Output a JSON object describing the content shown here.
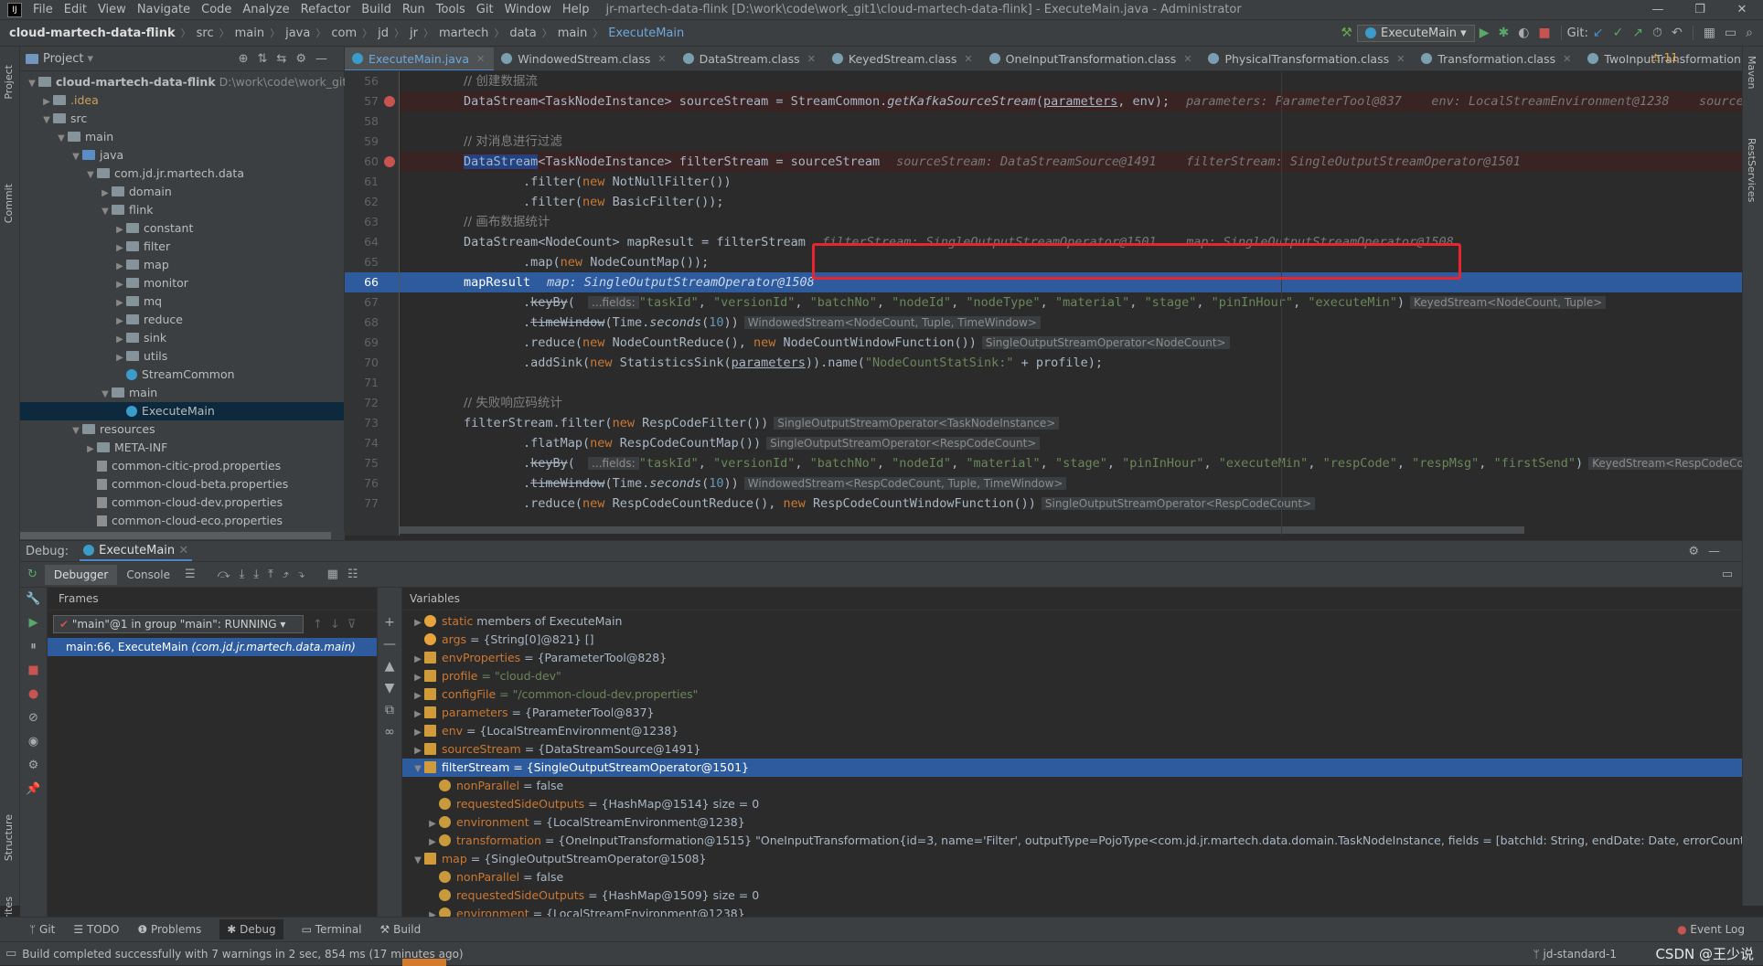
{
  "menu": [
    "File",
    "Edit",
    "View",
    "Navigate",
    "Code",
    "Analyze",
    "Refactor",
    "Build",
    "Run",
    "Tools",
    "Git",
    "Window",
    "Help"
  ],
  "window_title": "jr-martech-data-flink [D:\\work\\code\\work_git1\\cloud-martech-data-flink] - ExecuteMain.java - Administrator",
  "breadcrumbs": [
    "cloud-martech-data-flink",
    "src",
    "main",
    "java",
    "com",
    "jd",
    "jr",
    "martech",
    "data",
    "main",
    "ExecuteMain"
  ],
  "run_config": "ExecuteMain",
  "git_label": "Git:",
  "project": {
    "header": "Project",
    "root_name": "cloud-martech-data-flink",
    "root_path": "D:\\work\\code\\work_git1\\c",
    "tree": [
      {
        "label": ".idea",
        "indent": 1,
        "type": "folder"
      },
      {
        "label": "src",
        "indent": 1,
        "type": "folder"
      },
      {
        "label": "main",
        "indent": 2,
        "type": "folder"
      },
      {
        "label": "java",
        "indent": 3,
        "type": "src"
      },
      {
        "label": "com.jd.jr.martech.data",
        "indent": 4,
        "type": "folder"
      },
      {
        "label": "domain",
        "indent": 5,
        "type": "folder"
      },
      {
        "label": "flink",
        "indent": 5,
        "type": "folder"
      },
      {
        "label": "constant",
        "indent": 6,
        "type": "folder"
      },
      {
        "label": "filter",
        "indent": 6,
        "type": "folder"
      },
      {
        "label": "map",
        "indent": 6,
        "type": "folder"
      },
      {
        "label": "monitor",
        "indent": 6,
        "type": "folder"
      },
      {
        "label": "mq",
        "indent": 6,
        "type": "folder"
      },
      {
        "label": "reduce",
        "indent": 6,
        "type": "folder"
      },
      {
        "label": "sink",
        "indent": 6,
        "type": "folder"
      },
      {
        "label": "utils",
        "indent": 6,
        "type": "folder"
      },
      {
        "label": "StreamCommon",
        "indent": 6,
        "type": "class"
      },
      {
        "label": "main",
        "indent": 5,
        "type": "folder"
      },
      {
        "label": "ExecuteMain",
        "indent": 6,
        "type": "class"
      },
      {
        "label": "resources",
        "indent": 3,
        "type": "folder"
      },
      {
        "label": "META-INF",
        "indent": 4,
        "type": "folder"
      },
      {
        "label": "common-citic-prod.properties",
        "indent": 4,
        "type": "prop"
      },
      {
        "label": "common-cloud-beta.properties",
        "indent": 4,
        "type": "prop"
      },
      {
        "label": "common-cloud-dev.properties",
        "indent": 4,
        "type": "prop"
      },
      {
        "label": "common-cloud-eco.properties",
        "indent": 4,
        "type": "prop"
      }
    ]
  },
  "tabs": [
    "ExecuteMain.java",
    "WindowedStream.class",
    "DataStream.class",
    "KeyedStream.class",
    "OneInputTransformation.class",
    "PhysicalTransformation.class",
    "Transformation.class",
    "TwoInputTransformation.class"
  ],
  "warnings": "⚠ 11",
  "editor": {
    "line_numbers": [
      "56",
      "57",
      "58",
      "59",
      "60",
      "61",
      "62",
      "63",
      "64",
      "65",
      "66",
      "67",
      "68",
      "69",
      "70",
      "71",
      "72",
      "73",
      "74",
      "75",
      "76",
      "77"
    ],
    "cmt56": "// 创建数据流",
    "cmt59": "// 对消息进行过滤",
    "cmt63": "// 画布数据统计",
    "cmt72": "// 失败响应码统计",
    "l57_inline": "parameters: ParameterTool@837    env: LocalStreamEnvironment@1238    sourceSt",
    "l60_inline": "sourceStream: DataStreamSource@1491    filterStream: SingleOutputStreamOperator@1501",
    "l64_inline": "filterStream: SingleOutputStreamOperator@1501    map: SingleOutputStreamOperator@1508",
    "l66_inline": "map: SingleOutputStreamOperator@1508",
    "fields_hint": "...fields:",
    "h67": "KeyedStream<NodeCount, Tuple>",
    "h68": "WindowedStream<NodeCount, Tuple, TimeWindow>",
    "h69": "SingleOutputStreamOperator<NodeCount>",
    "h73": "SingleOutputStreamOperator<TaskNodeInstance>",
    "h74": "SingleOutputStreamOperator<RespCodeCount>",
    "h75": "KeyedStream<RespCodeCount",
    "h76": "WindowedStream<RespCodeCount, Tuple, TimeWindow>",
    "h77": "SingleOutputStreamOperator<RespCodeCount>"
  },
  "debug": {
    "label": "Debug:",
    "session": "ExecuteMain",
    "tab_debugger": "Debugger",
    "tab_console": "Console",
    "frames_label": "Frames",
    "variables_label": "Variables",
    "thread": "\"main\"@1 in group \"main\": RUNNING",
    "frame": "main:66, ExecuteMain",
    "frame_pkg": "(com.jd.jr.martech.data.main)",
    "vars": [
      {
        "name": "static",
        "value": "members of ExecuteMain",
        "indent": 0,
        "icon": "static",
        "expand": "right"
      },
      {
        "name": "args",
        "value": "= {String[0]@821} []",
        "indent": 0,
        "icon": "param",
        "expand": ""
      },
      {
        "name": "envProperties",
        "value": "= {ParameterTool@828}",
        "indent": 0,
        "icon": "list",
        "expand": "right"
      },
      {
        "name": "profile",
        "value": "= \"cloud-dev\"",
        "indent": 0,
        "icon": "list",
        "expand": "right"
      },
      {
        "name": "configFile",
        "value": "= \"/common-cloud-dev.properties\"",
        "indent": 0,
        "icon": "list",
        "expand": "right"
      },
      {
        "name": "parameters",
        "value": "= {ParameterTool@837}",
        "indent": 0,
        "icon": "list",
        "expand": "right"
      },
      {
        "name": "env",
        "value": "= {LocalStreamEnvironment@1238}",
        "indent": 0,
        "icon": "list",
        "expand": "right"
      },
      {
        "name": "sourceStream",
        "value": "= {DataStreamSource@1491}",
        "indent": 0,
        "icon": "list",
        "expand": "right"
      },
      {
        "name": "filterStream",
        "value": "= {SingleOutputStreamOperator@1501}",
        "indent": 0,
        "icon": "list",
        "expand": "down",
        "sel": true
      },
      {
        "name": "nonParallel",
        "value": "= false",
        "indent": 1,
        "icon": "field",
        "expand": ""
      },
      {
        "name": "requestedSideOutputs",
        "value": "= {HashMap@1514}  size = 0",
        "indent": 1,
        "icon": "field",
        "expand": ""
      },
      {
        "name": "environment",
        "value": "= {LocalStreamEnvironment@1238}",
        "indent": 1,
        "icon": "field",
        "expand": "right"
      },
      {
        "name": "transformation",
        "value": "= {OneInputTransformation@1515} \"OneInputTransformation{id=3, name='Filter', outputType=PojoType<com.jd.jr.martech.data.domain.TaskNodeInstance, fields = [batchId: String, endDate: Date, errorCount: Long, err... View",
        "indent": 1,
        "icon": "field",
        "expand": "right"
      },
      {
        "name": "map",
        "value": "= {SingleOutputStreamOperator@1508}",
        "indent": 0,
        "icon": "list",
        "expand": "down"
      },
      {
        "name": "nonParallel",
        "value": "= false",
        "indent": 1,
        "icon": "field",
        "expand": ""
      },
      {
        "name": "requestedSideOutputs",
        "value": "= {HashMap@1509}  size = 0",
        "indent": 1,
        "icon": "field",
        "expand": ""
      },
      {
        "name": "environment",
        "value": "= {LocalStreamEnvironment@1238}",
        "indent": 1,
        "icon": "field",
        "expand": "right"
      }
    ]
  },
  "bottom_tools": [
    "Git",
    "TODO",
    "Problems",
    "Debug",
    "Terminal",
    "Build"
  ],
  "event_log": "Event Log",
  "status_text": "Build completed successfully with 7 warnings in 2 sec, 854 ms (17 minutes ago)",
  "status_right": "jd-standard-1",
  "watermark": "CSDN @王少说",
  "side_labels": {
    "project": "Project",
    "commit": "Commit",
    "structure": "Structure",
    "favorites": "Favorites",
    "maven": "Maven",
    "rest": "RestServices"
  }
}
